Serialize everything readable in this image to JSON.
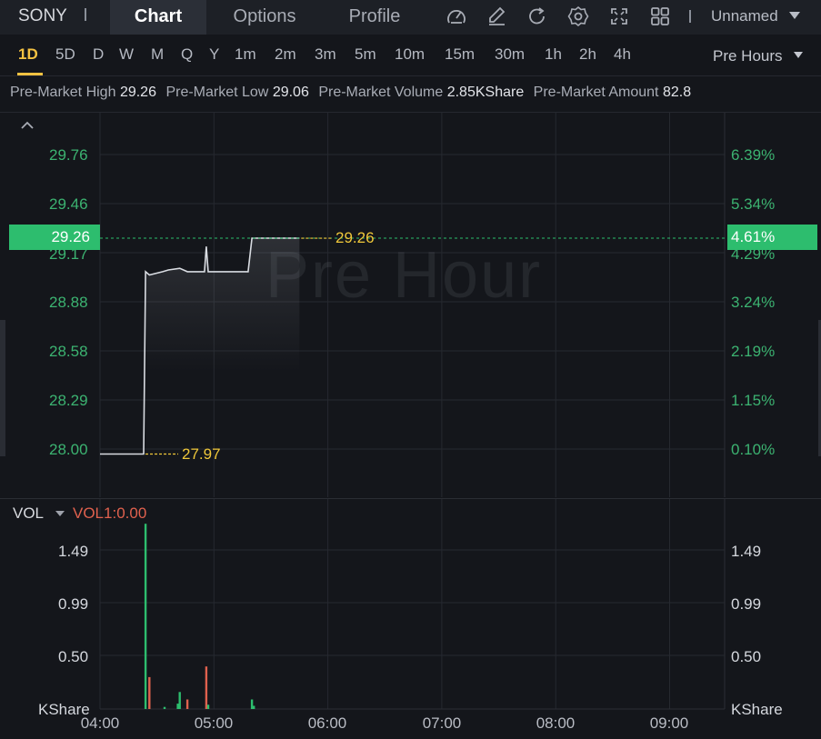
{
  "header": {
    "ticker": "SONY",
    "tabs": [
      {
        "label": "Chart",
        "active": true
      },
      {
        "label": "Options",
        "active": false
      },
      {
        "label": "Profile",
        "active": false
      }
    ],
    "tools": [
      "indicator-icon",
      "draw-icon",
      "refresh-icon",
      "settings-icon",
      "fullscreen-icon",
      "layout-grid-icon"
    ],
    "layout_name": "Unnamed"
  },
  "intervals": {
    "items": [
      "1D",
      "5D",
      "D",
      "W",
      "M",
      "Q",
      "Y",
      "1m",
      "2m",
      "3m",
      "5m",
      "10m",
      "15m",
      "30m",
      "1h",
      "2h",
      "4h"
    ],
    "active": "1D",
    "session": "Pre Hours"
  },
  "info": {
    "high_label": "Pre-Market High",
    "high_value": "29.26",
    "low_label": "Pre-Market Low",
    "low_value": "29.06",
    "volume_label": "Pre-Market Volume",
    "volume_value": "2.85KShare",
    "amount_label": "Pre-Market Amount",
    "amount_value": "82.8"
  },
  "chart": {
    "watermark": "Pre Hour",
    "price_axis": [
      "29.76",
      "29.46",
      "29.17",
      "28.88",
      "28.58",
      "28.29",
      "28.00"
    ],
    "pct_axis": [
      "6.39%",
      "5.34%",
      "4.29%",
      "3.24%",
      "2.19%",
      "1.15%",
      "0.10%"
    ],
    "current_price": "29.26",
    "current_pct": "4.61%",
    "high_marker": "29.26",
    "low_marker": "27.97",
    "colors": {
      "up": "#2dbd6e",
      "down": "#e0614e",
      "marker": "#f0c83a",
      "line": "#d9dce2"
    }
  },
  "volume": {
    "title": "VOL",
    "indicator": "VOL1:0.00",
    "axis_left": [
      "1.49",
      "0.99",
      "0.50"
    ],
    "axis_right": [
      "1.49",
      "0.99",
      "0.50"
    ],
    "unit": "KShare"
  },
  "time_axis": [
    "04:00",
    "05:00",
    "06:00",
    "07:00",
    "08:00",
    "09:00"
  ],
  "chart_data": {
    "type": "line",
    "x_range": [
      "04:00",
      "09:30"
    ],
    "ylim": [
      27.9,
      29.9
    ],
    "price_series": [
      {
        "t": "04:00",
        "v": 27.97
      },
      {
        "t": "04:23",
        "v": 27.97
      },
      {
        "t": "04:24",
        "v": 29.06
      },
      {
        "t": "04:26",
        "v": 29.04
      },
      {
        "t": "04:33",
        "v": 29.06
      },
      {
        "t": "04:36",
        "v": 29.07
      },
      {
        "t": "04:42",
        "v": 29.08
      },
      {
        "t": "04:46",
        "v": 29.06
      },
      {
        "t": "04:55",
        "v": 29.06
      },
      {
        "t": "04:56",
        "v": 29.21
      },
      {
        "t": "04:57",
        "v": 29.06
      },
      {
        "t": "05:18",
        "v": 29.06
      },
      {
        "t": "05:20",
        "v": 29.26
      },
      {
        "t": "05:45",
        "v": 29.26
      }
    ],
    "volume_series": [
      {
        "t": "04:24",
        "v": 1.74,
        "dir": "up"
      },
      {
        "t": "04:26",
        "v": 0.3,
        "dir": "down"
      },
      {
        "t": "04:34",
        "v": 0.02,
        "dir": "up"
      },
      {
        "t": "04:41",
        "v": 0.05,
        "dir": "up"
      },
      {
        "t": "04:42",
        "v": 0.16,
        "dir": "up"
      },
      {
        "t": "04:46",
        "v": 0.09,
        "dir": "down"
      },
      {
        "t": "04:56",
        "v": 0.4,
        "dir": "down"
      },
      {
        "t": "04:57",
        "v": 0.04,
        "dir": "up"
      },
      {
        "t": "05:20",
        "v": 0.09,
        "dir": "up"
      },
      {
        "t": "05:21",
        "v": 0.03,
        "dir": "up"
      }
    ],
    "vol_ylim": [
      0,
      1.9
    ]
  }
}
